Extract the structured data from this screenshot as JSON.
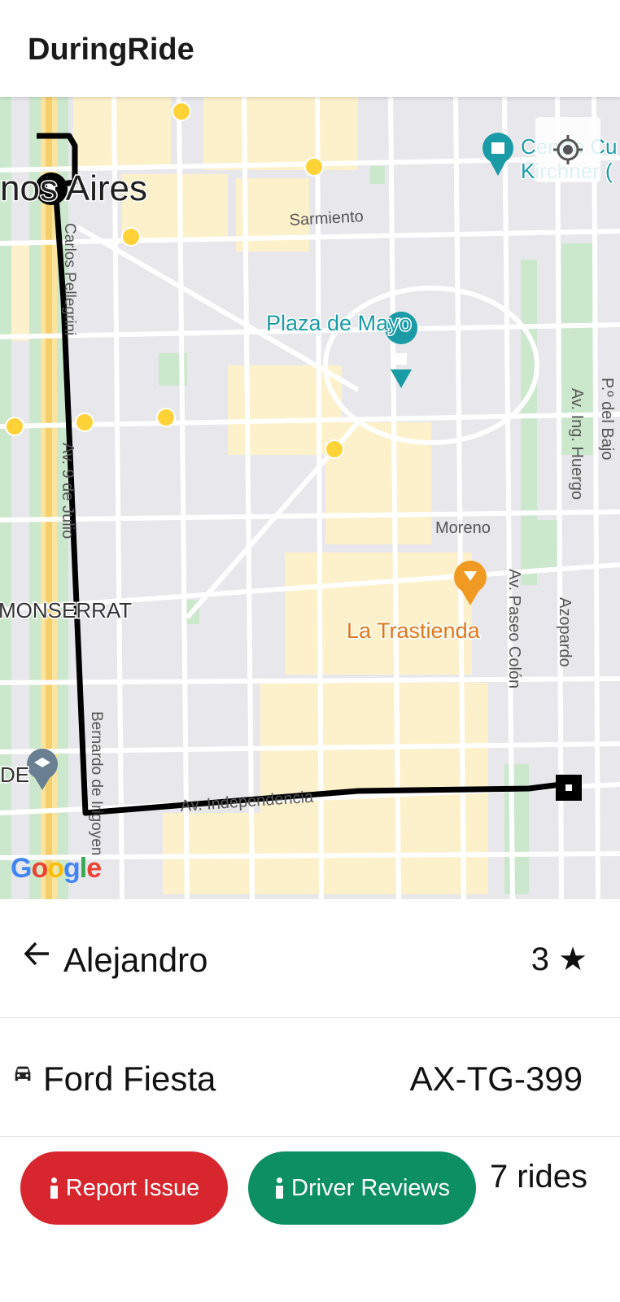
{
  "app": {
    "title": "DuringRide"
  },
  "map": {
    "labels": {
      "city": "nos Aires",
      "sarmiento": "Sarmiento",
      "plaza": "Plaza de Mayo",
      "carlos": "Carlos Pellegrini",
      "julio": "Av. 9 de Julio",
      "moreno": "Moreno",
      "monserrat": "MONSERRAT",
      "trastienda": "La Trastienda",
      "paseo": "Av. Paseo Colón",
      "azopardo": "Azopardo",
      "huergo": "Av. Ing. Huergo",
      "bajo": "P.º del Bajo",
      "bernardo": "Bernardo de Irigoyen",
      "independencia": "Av. Independencia",
      "ccentro": "Centro Cu",
      "kirchner": "Kirchner (",
      "de": "DE",
      "subte": "Subte"
    },
    "google": [
      "G",
      "o",
      "o",
      "g",
      "l",
      "e"
    ],
    "google_colors": [
      "#4285F4",
      "#EA4335",
      "#FBBC05",
      "#4285F4",
      "#34A853",
      "#EA4335"
    ],
    "route_color": "#000000"
  },
  "driver": {
    "name": "Alejandro",
    "rating": "3 ★"
  },
  "vehicle": {
    "model": "Ford Fiesta",
    "plate": "AX-TG-399"
  },
  "actions": {
    "report_label": "Report Issue",
    "reviews_label": "Driver Reviews"
  },
  "stats": {
    "rides": "7 rides"
  },
  "colors": {
    "report": "#d8262e",
    "reviews": "#0b8f63",
    "accent_teal": "#1a9ba6",
    "poi_orange": "#f09a24"
  }
}
